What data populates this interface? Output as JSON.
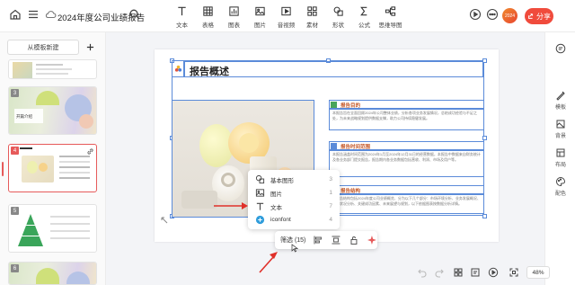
{
  "app": {
    "title": "2024年度公司业绩报告"
  },
  "toolbar": {
    "tools": [
      {
        "label": "文本",
        "icon": "text-icon"
      },
      {
        "label": "表格",
        "icon": "table-icon"
      },
      {
        "label": "图表",
        "icon": "chart-icon"
      },
      {
        "label": "图片",
        "icon": "image-icon"
      },
      {
        "label": "音视频",
        "icon": "media-icon"
      },
      {
        "label": "素材",
        "icon": "material-icon"
      },
      {
        "label": "形状",
        "icon": "shape-icon"
      },
      {
        "label": "公式",
        "icon": "formula-icon"
      },
      {
        "label": "思维导图",
        "icon": "mindmap-icon"
      }
    ],
    "share_label": "分享"
  },
  "left_panel": {
    "new_from_template": "从模板新建",
    "slides": [
      {
        "number": "2"
      },
      {
        "number": "3",
        "caption": "开篇介绍"
      },
      {
        "number": "4"
      },
      {
        "number": "5"
      },
      {
        "number": "6"
      }
    ]
  },
  "right_rail": [
    {
      "label": "",
      "icon": "comment-icon"
    },
    {
      "label": "模板",
      "icon": "template-icon"
    },
    {
      "label": "背景",
      "icon": "background-icon"
    },
    {
      "label": "布局",
      "icon": "layout-icon"
    },
    {
      "label": "配色",
      "icon": "palette-icon"
    }
  ],
  "slide": {
    "title": "报告概述",
    "sections": [
      {
        "heading": "报告目的",
        "body": "本报告旨在全面回顾2024年公司整体业绩，分析各项业务发展情况，总结成功经验与不足之处，为未来战略规划提供数据支撑，助力公司持续稳健发展。"
      },
      {
        "heading": "报告时间范围",
        "body": "本报告涵盖时间范围为2024年1月至2024年12月31日的经营数据，本报告中数据来自财务统计及各业务部门提交报告，报告期内各业务数据包括营收、利润、市场及用户等。"
      },
      {
        "heading": "报告结构",
        "body": "本报告结构包括2024年度公司业绩概览、分为以下几个部分：市场环境分析、业务发展概况、财务状况分析、关键成功因素、未来展望与规划，以下依据图表按数据分析详情。"
      }
    ]
  },
  "context_menu": {
    "items": [
      {
        "label": "基本图形",
        "count": "3",
        "icon": "shape-icon"
      },
      {
        "label": "图片",
        "count": "1",
        "icon": "image-icon"
      },
      {
        "label": "文本",
        "count": "7",
        "icon": "text-icon"
      },
      {
        "label": "iconfont",
        "count": "4",
        "icon": "iconfont-icon"
      }
    ]
  },
  "float_toolbar": {
    "filter_label": "筛选 (15)"
  },
  "zoom": {
    "level": "48%"
  }
}
